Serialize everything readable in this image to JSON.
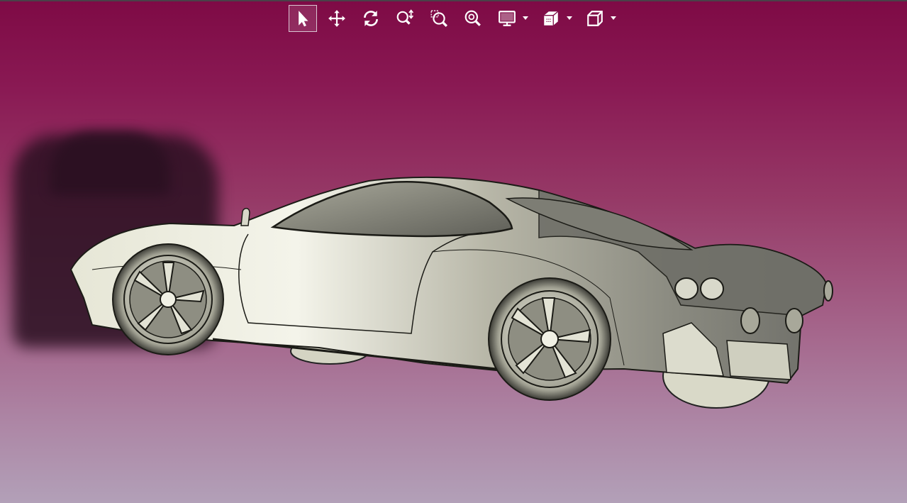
{
  "toolbar": {
    "tools": [
      {
        "name": "select",
        "icon": "cursor-arrow-icon",
        "active": true
      },
      {
        "name": "pan",
        "icon": "move-arrows-icon",
        "active": false
      },
      {
        "name": "rotate",
        "icon": "rotate-icon",
        "active": false
      },
      {
        "name": "zoom",
        "icon": "zoom-in-out-icon",
        "active": false
      },
      {
        "name": "zoom-window",
        "icon": "zoom-window-icon",
        "active": false
      },
      {
        "name": "zoom-fit",
        "icon": "zoom-fit-icon",
        "active": false
      }
    ],
    "dropdowns": [
      {
        "name": "display-mode",
        "icon": "monitor-icon"
      },
      {
        "name": "section-view",
        "icon": "section-plane-icon"
      },
      {
        "name": "view-orientation",
        "icon": "cube-view-icon"
      }
    ]
  },
  "scene": {
    "model": "sports-car-3d-model",
    "background_top": "#7e0a45",
    "background_bottom": "#b2a0b8",
    "body_color": "#c9c8b6",
    "edge_color": "#1b1b16"
  }
}
